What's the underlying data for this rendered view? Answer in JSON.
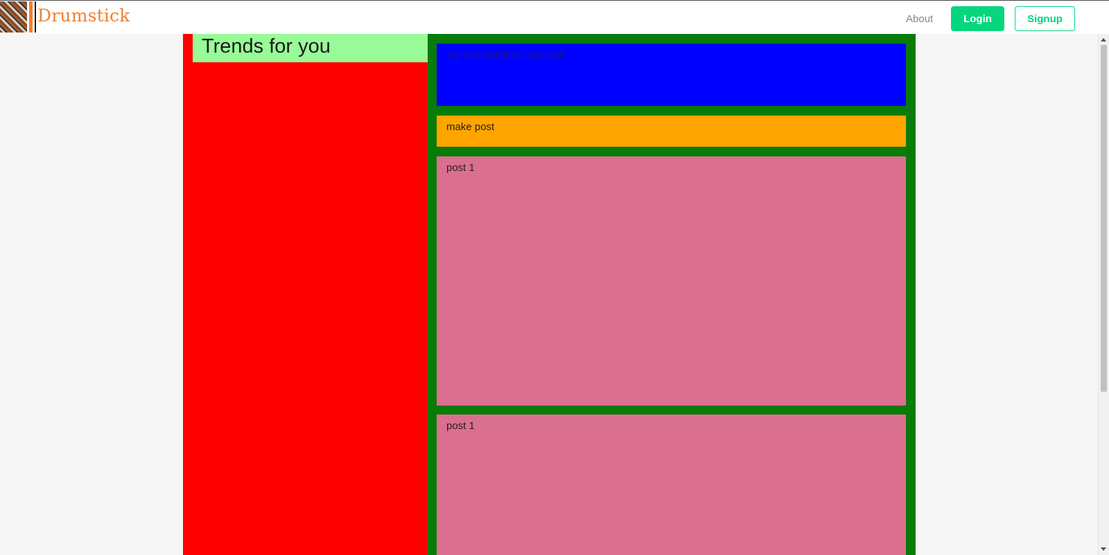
{
  "navbar": {
    "brand": "Drumstick",
    "about_label": "About",
    "login_label": "Login",
    "signup_label": "Signup"
  },
  "sidebar": {
    "title": "Trends for you"
  },
  "feed": {
    "carousel_label": "my communities carousel",
    "make_post_label": "make post",
    "posts": [
      {
        "label": "post 1"
      },
      {
        "label": "post 1"
      }
    ]
  },
  "colors": {
    "brand_orange": "#f07f30",
    "accent_green": "#06d67e",
    "sidebar_red": "#ff0000",
    "trends_header": "#98fb98",
    "feed_green": "#087b08",
    "carousel_blue": "#0000ff",
    "make_post_orange": "#ffa500",
    "post_pink": "#db6f8f"
  },
  "icons": [
    "brand-logo-icon",
    "scroll-up-arrow-icon",
    "scroll-down-arrow-icon"
  ]
}
